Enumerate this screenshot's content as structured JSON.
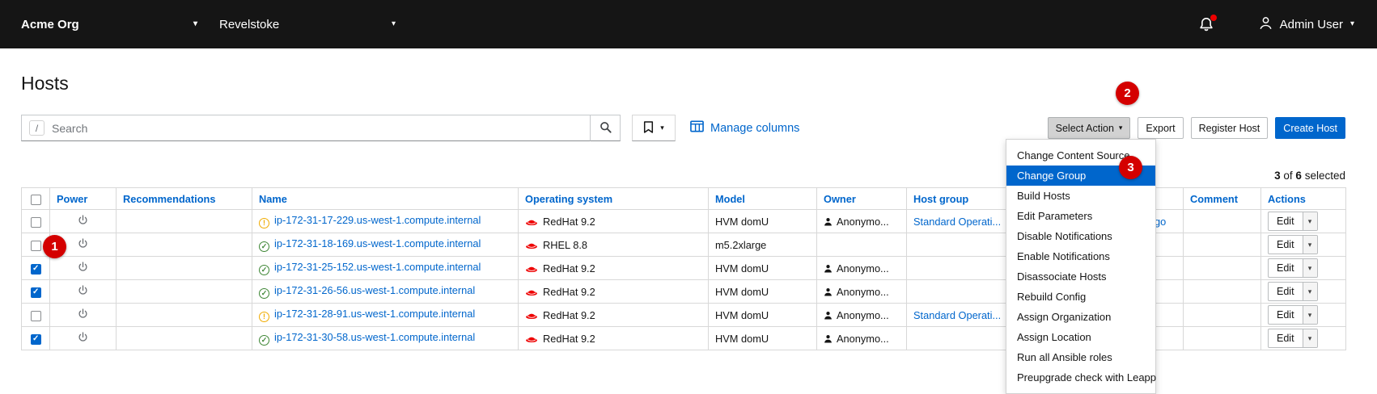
{
  "colors": {
    "accent": "#0066cc",
    "masthead": "#151515",
    "annotation": "#d40000",
    "warning": "#f0ab00",
    "ok": "#3e8635",
    "redhat": "#ee0000"
  },
  "masthead": {
    "org": "Acme Org",
    "location": "Revelstoke",
    "user": "Admin User"
  },
  "page": {
    "title": "Hosts"
  },
  "toolbar": {
    "search_shortcut": "/",
    "search_placeholder": "Search",
    "manage_columns": "Manage columns",
    "select_action": "Select Action",
    "export": "Export",
    "register_host": "Register Host",
    "create_host": "Create Host"
  },
  "action_menu": {
    "selected": "Change Group",
    "items": [
      "Change Content Source",
      "Change Group",
      "Build Hosts",
      "Edit Parameters",
      "Disable Notifications",
      "Enable Notifications",
      "Disassociate Hosts",
      "Rebuild Config",
      "Assign Organization",
      "Assign Location",
      "Run all Ansible roles",
      "Preupgrade check with Leapp"
    ]
  },
  "selection": {
    "count": "3",
    "of_label": "of",
    "total": "6",
    "selected_label": "selected"
  },
  "annotations": {
    "step1": "1",
    "step2": "2",
    "step3": "3"
  },
  "table": {
    "action_label": "Edit",
    "headers": [
      "Power",
      "Recommendations",
      "Name",
      "Operating system",
      "Model",
      "Owner",
      "Host group",
      "",
      "Comment",
      "Actions"
    ],
    "rows": [
      {
        "checked": false,
        "status": "warning",
        "name": "ip-172-31-17-229.us-west-1.compute.internal",
        "os": "RedHat 9.2",
        "model": "HVM domU",
        "owner": "Anonymo...",
        "host_group": "Standard Operati...",
        "last_report_partial": "go",
        "comment": ""
      },
      {
        "checked": false,
        "status": "ok",
        "name": "ip-172-31-18-169.us-west-1.compute.internal",
        "os": "RHEL 8.8",
        "model": "m5.2xlarge",
        "owner": "",
        "host_group": "",
        "last_report_partial": "",
        "comment": ""
      },
      {
        "checked": true,
        "status": "ok",
        "name": "ip-172-31-25-152.us-west-1.compute.internal",
        "os": "RedHat 9.2",
        "model": "HVM domU",
        "owner": "Anonymo...",
        "host_group": "",
        "last_report_partial": "",
        "comment": ""
      },
      {
        "checked": true,
        "status": "ok",
        "name": "ip-172-31-26-56.us-west-1.compute.internal",
        "os": "RedHat 9.2",
        "model": "HVM domU",
        "owner": "Anonymo...",
        "host_group": "",
        "last_report_partial": "",
        "comment": ""
      },
      {
        "checked": false,
        "status": "warning",
        "name": "ip-172-31-28-91.us-west-1.compute.internal",
        "os": "RedHat 9.2",
        "model": "HVM domU",
        "owner": "Anonymo...",
        "host_group": "Standard Operati...",
        "last_report_partial": "",
        "comment": ""
      },
      {
        "checked": true,
        "status": "ok",
        "name": "ip-172-31-30-58.us-west-1.compute.internal",
        "os": "RedHat 9.2",
        "model": "HVM domU",
        "owner": "Anonymo...",
        "host_group": "",
        "last_report_partial": "",
        "comment": ""
      }
    ]
  }
}
